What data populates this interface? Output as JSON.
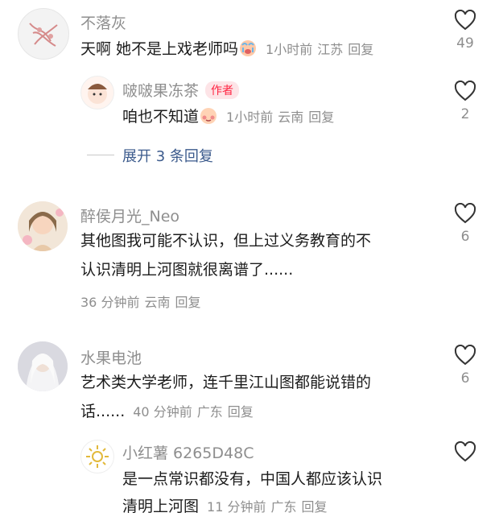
{
  "comments": [
    {
      "username": "不落灰",
      "text": "天啊 她不是上戏老师吗",
      "emoji": "crying-face",
      "time": "1小时前",
      "location": "江苏",
      "reply": "回复",
      "likes": "49",
      "reply_thread": {
        "username": "啵啵果冻茶",
        "author_tag": "作者",
        "text": "咱也不知道",
        "emoji": "blush-face",
        "time": "1小时前",
        "location": "云南",
        "reply": "回复",
        "likes": "2"
      },
      "expand_label": "展开 3 条回复"
    },
    {
      "username": "醉侯月光_Neo",
      "text_line1": "其他图我可能不认识，但上过义务教育的不",
      "text_line2": "认识清明上河图就很离谱了......",
      "time": "36 分钟前",
      "location": "云南",
      "reply": "回复",
      "likes": "6"
    },
    {
      "username": "水果电池",
      "text_line1": "艺术类大学老师，连千里江山图都能说错的",
      "text_line2": "话......",
      "time": "40 分钟前",
      "location": "广东",
      "reply": "回复",
      "likes": "6",
      "reply_thread": {
        "username": "小红薯 6265D48C",
        "text_line1": "是一点常识都没有，中国人都应该认识",
        "text_line2": "清明上河图",
        "time": "11 分钟前",
        "location": "广东",
        "reply": "回复"
      }
    }
  ]
}
